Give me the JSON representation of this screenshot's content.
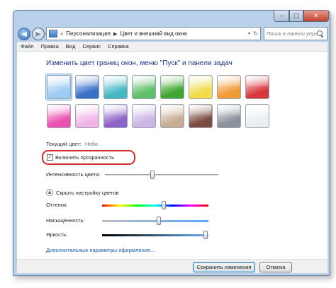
{
  "window": {
    "controls": {
      "minimize": "–",
      "maximize": "□",
      "close": "✕"
    }
  },
  "nav": {
    "back": "◀",
    "forward": "▶",
    "dropdown": "▾",
    "breadcrumb": [
      "«",
      "Персонализация",
      "Цвет и внешний вид окна"
    ],
    "separator": "▶",
    "address_dropdown": "▾",
    "refresh": "↻",
    "search_placeholder": "Поиск в панели управл..."
  },
  "menu": [
    "Файл",
    "Правка",
    "Вид",
    "Сервис",
    "Справка"
  ],
  "main": {
    "heading": "Изменить цвет границ окон, меню \"Пуск\" и панели задач",
    "swatches": [
      {
        "name": "sky",
        "color": "#9ccbf3"
      },
      {
        "name": "twilight",
        "color": "#3a6fc7"
      },
      {
        "name": "sea",
        "color": "#46b7c5"
      },
      {
        "name": "leaf",
        "color": "#5fbf6a"
      },
      {
        "name": "lime",
        "color": "#3ea630"
      },
      {
        "name": "lemon",
        "color": "#f2dc4a"
      },
      {
        "name": "pumpkin",
        "color": "#ef9a34"
      },
      {
        "name": "ruby",
        "color": "#d9363b"
      },
      {
        "name": "fuchsia",
        "color": "#eb4fb2"
      },
      {
        "name": "blush",
        "color": "#f1b6e8"
      },
      {
        "name": "violet",
        "color": "#8c62c8"
      },
      {
        "name": "lavender",
        "color": "#cab5e3"
      },
      {
        "name": "taupe",
        "color": "#c8ad96"
      },
      {
        "name": "chocolate",
        "color": "#7a4a43"
      },
      {
        "name": "slate",
        "color": "#8c929c"
      },
      {
        "name": "frost",
        "color": "#ebeef1"
      }
    ],
    "current_color_label": "Текущий цвет:",
    "current_color_value": "Небо",
    "transparency_label": "Включить прозрачность",
    "transparency_checked": "✓",
    "intensity_label": "Интенсивность цвета:",
    "intensity_value": 0.42,
    "mixer_toggle_icon": "▲",
    "mixer_toggle_label": "Скрыть настройку цветов",
    "hue_label": "Оттенок:",
    "hue_value": 0.58,
    "saturation_label": "Насыщенность:",
    "saturation_value": 0.53,
    "brightness_label": "Яркость:",
    "brightness_value": 0.97,
    "advanced_link": "Дополнительные параметры оформления..."
  },
  "footer": {
    "save_label": "Сохранить изменения",
    "cancel_label": "Отмена"
  },
  "colors": {
    "highlight": "#d42a2a",
    "heading": "#1e3287",
    "link": "#1a5fb4"
  }
}
